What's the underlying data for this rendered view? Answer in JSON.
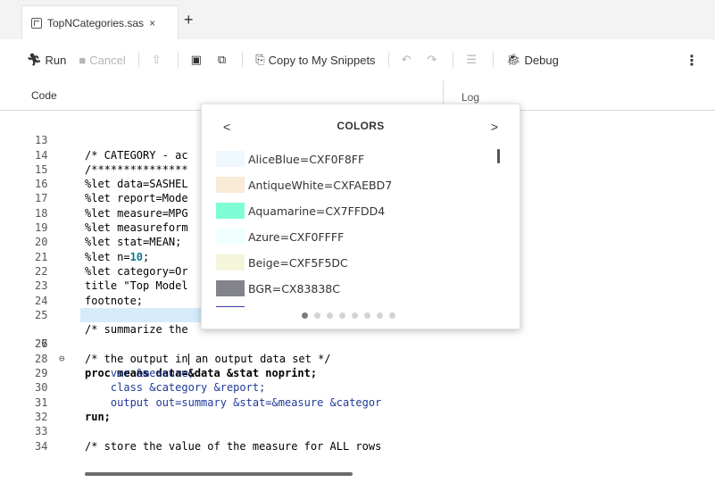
{
  "tabs": [
    {
      "label": "TopNCategories.sas",
      "close": "×"
    }
  ],
  "new_tab": "+",
  "toolbar": {
    "run": "Run",
    "cancel": "Cancel",
    "copy_snippets": "Copy to My Snippets",
    "debug": "Debug",
    "more": "⋮"
  },
  "panes": {
    "code": "Code",
    "log": "Log"
  },
  "code_lines": [
    {
      "num": "13",
      "text": "/* CATEGORY - ac"
    },
    {
      "num": "14",
      "text": "/***************"
    },
    {
      "num": "15",
      "text": "%let data=SASHEL"
    },
    {
      "num": "16",
      "text": "%let report=Mode"
    },
    {
      "num": "17",
      "text": "%let measure=MPG"
    },
    {
      "num": "18",
      "text": "%let measureform"
    },
    {
      "num": "19",
      "text": "%let stat=MEAN;"
    },
    {
      "num": "20",
      "text": "%let n=10;"
    },
    {
      "num": "21",
      "text": "%let category=Or"
    },
    {
      "num": "22",
      "text": "title \"Top Model"
    },
    {
      "num": "23",
      "text": "footnote;"
    },
    {
      "num": "24",
      "text": ""
    },
    {
      "num": "25",
      "text": "/* summarize the"
    },
    {
      "num": "26",
      "text": "/* the output in an output data set */"
    },
    {
      "num": "27",
      "text": "proc means data=&data &stat noprint;"
    },
    {
      "num": "28",
      "text": "    var &measure;"
    },
    {
      "num": "29",
      "text": "    class &category &report;"
    },
    {
      "num": "30",
      "text": "    output out=summary &stat=&measure &categor"
    },
    {
      "num": "31",
      "text": "run;"
    },
    {
      "num": "32",
      "text": ""
    },
    {
      "num": "33",
      "text": "/* store the value of the measure for ALL rows"
    },
    {
      "num": "34",
      "text": ""
    }
  ],
  "fold_marker": "⊖",
  "popup": {
    "title": "COLORS",
    "prev": "<",
    "next": ">",
    "colors": [
      {
        "label": "AliceBlue=CXF0F8FF",
        "hex": "#F0F8FF"
      },
      {
        "label": "AntiqueWhite=CXFAEBD7",
        "hex": "#FAEBD7"
      },
      {
        "label": "Aquamarine=CX7FFDD4",
        "hex": "#7FFDD4"
      },
      {
        "label": "Azure=CXF0FFFF",
        "hex": "#F0FFFF"
      },
      {
        "label": "Beige=CXF5F5DC",
        "hex": "#F5F5DC"
      },
      {
        "label": "BGR=CX83838C",
        "hex": "#83838C"
      }
    ],
    "pages": 8,
    "active_page": 1
  }
}
